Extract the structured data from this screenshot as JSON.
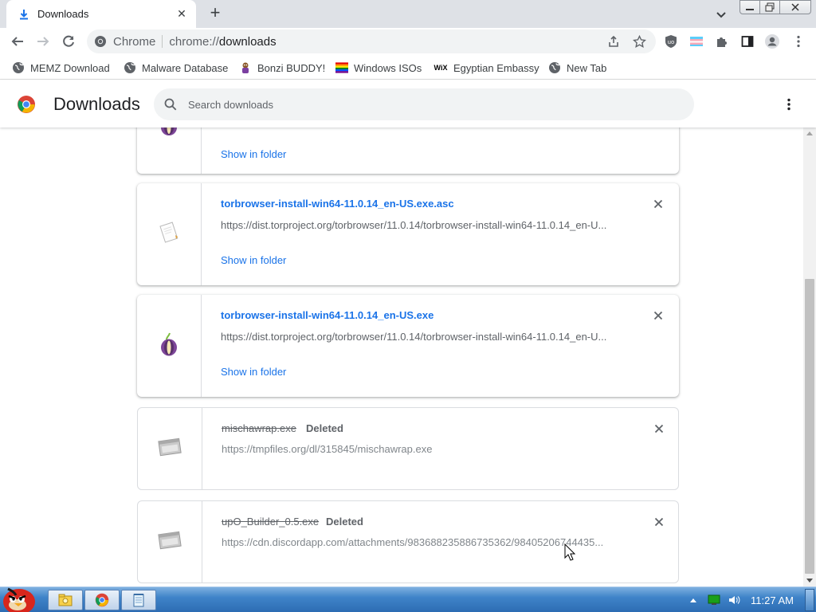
{
  "browser": {
    "tab": {
      "title": "Downloads"
    },
    "toolbar": {
      "scheme_label": "Chrome",
      "url_host": "chrome://",
      "url_path": "downloads"
    },
    "bookmarks": [
      {
        "label": "MEMZ Download",
        "icon": "globe-icon"
      },
      {
        "label": "Malware Database",
        "icon": "globe-icon"
      },
      {
        "label": "Bonzi BUDDY!",
        "icon": "bonzi-icon"
      },
      {
        "label": "Windows ISOs",
        "icon": "rainbow-flag-icon"
      },
      {
        "label": "Egyptian Embassy",
        "icon": "wix-icon"
      },
      {
        "label": "New Tab",
        "icon": "globe-icon"
      }
    ]
  },
  "page": {
    "title": "Downloads",
    "search_placeholder": "Search downloads"
  },
  "downloads": [
    {
      "filename": "",
      "url": "",
      "show_in_folder": "Show in folder",
      "icon": "tor-onion-icon"
    },
    {
      "filename": "torbrowser-install-win64-11.0.14_en-US.exe.asc",
      "url": "https://dist.torproject.org/torbrowser/11.0.14/torbrowser-install-win64-11.0.14_en-U...",
      "show_in_folder": "Show in folder",
      "icon": "document-icon"
    },
    {
      "filename": "torbrowser-install-win64-11.0.14_en-US.exe",
      "url": "https://dist.torproject.org/torbrowser/11.0.14/torbrowser-install-win64-11.0.14_en-U...",
      "show_in_folder": "Show in folder",
      "icon": "tor-onion-icon"
    },
    {
      "filename": "mischawrap.exe",
      "status": "Deleted",
      "url": "https://tmpfiles.org/dl/315845/mischawrap.exe",
      "icon": "exe-file-icon"
    },
    {
      "filename": "upO_Builder_0.5.exe",
      "status": "Deleted",
      "url": "https://cdn.discordapp.com/attachments/983688235886735362/98405206744435...",
      "icon": "exe-file-icon"
    }
  ],
  "taskbar": {
    "clock": "11:27 AM"
  },
  "colors": {
    "link_blue": "#1a73e8",
    "tabstrip": "#dee1e6",
    "taskbar_blue": "#3f84c9"
  }
}
